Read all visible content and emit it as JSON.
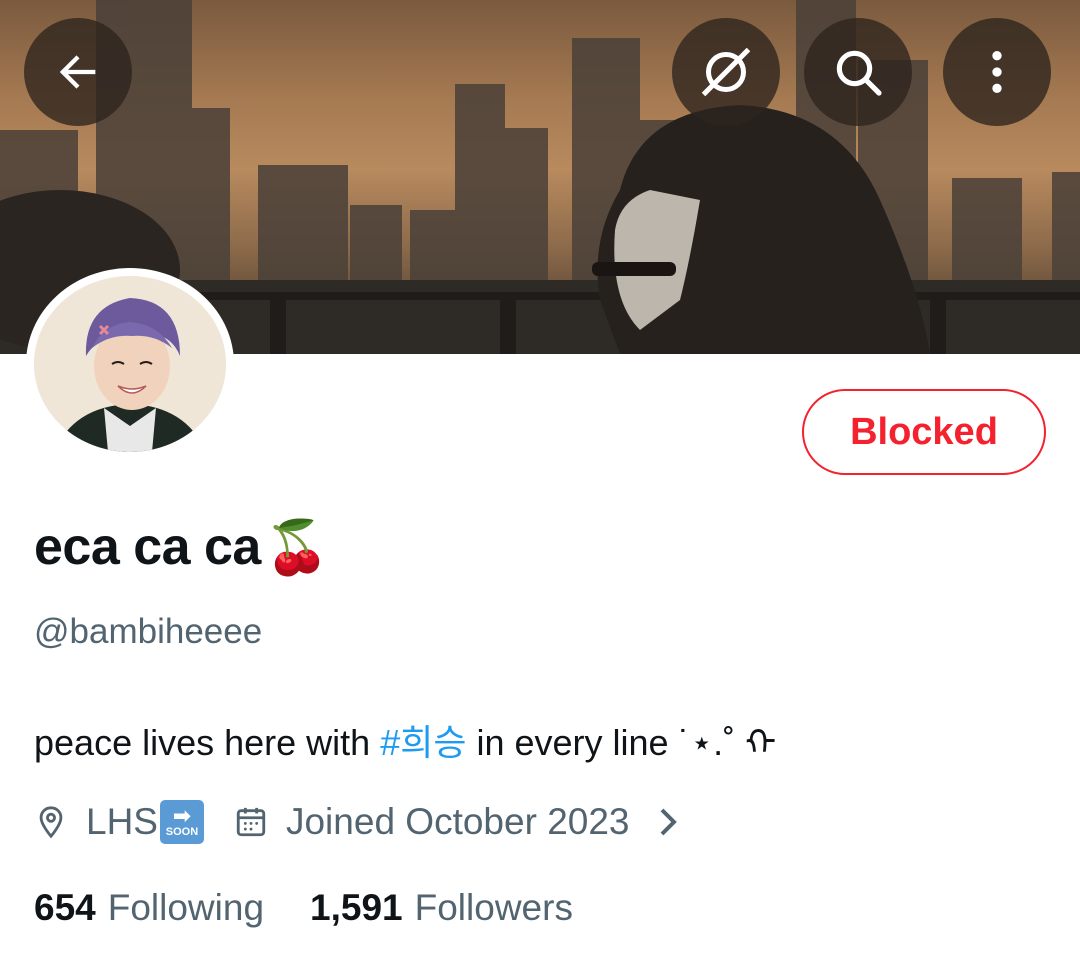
{
  "header": {
    "back_icon": "arrow-left-icon",
    "translate_icon": "translate-slash-icon",
    "search_icon": "search-icon",
    "more_icon": "more-vertical-icon"
  },
  "profile": {
    "display_name": "eca ca ca",
    "display_name_emoji": "🍒",
    "handle": "@bambiheeee",
    "bio_before": "peace lives here with ",
    "bio_hashtag": "#희승",
    "bio_after": " in every line ˙⋆.˚ ᡣ",
    "location": "LHS",
    "location_emoji_arrow": "➡",
    "location_emoji_text": "SOON",
    "joined": "Joined October 2023"
  },
  "actions": {
    "blocked_label": "Blocked"
  },
  "stats": {
    "following_count": "654",
    "following_label": "Following",
    "followers_count": "1,591",
    "followers_label": "Followers"
  },
  "colors": {
    "accent_blue": "#1d9bf0",
    "blocked_red": "#f4212e",
    "secondary_text": "#536471"
  }
}
